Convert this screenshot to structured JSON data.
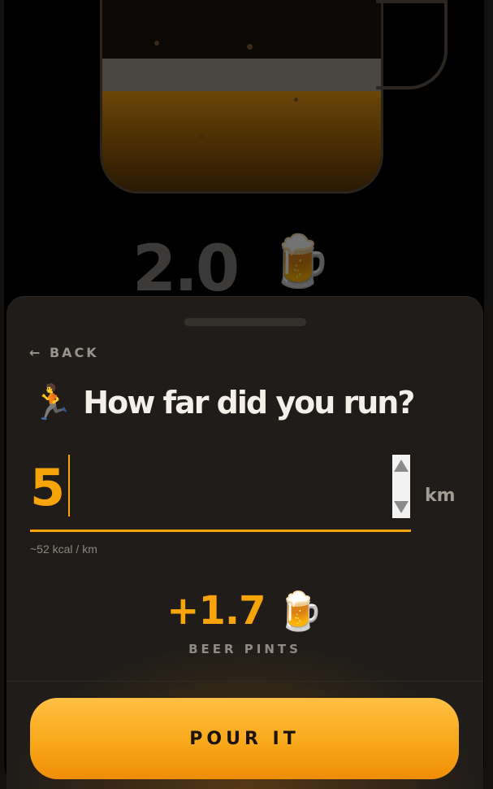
{
  "background": {
    "pints_value": "2.0",
    "pints_icon": "🍺"
  },
  "sheet": {
    "back_label": "← BACK",
    "activity_emoji": "🏃",
    "question": "How far did you run?",
    "distance_input": {
      "value": "5"
    },
    "unit": "km",
    "hint": "~52 kcal / km",
    "result": {
      "value": "+1.7",
      "icon": "🍺",
      "label": "BEER PINTS"
    },
    "pour_button_label": "POUR IT"
  },
  "colors": {
    "accent": "#f6a40a",
    "sheet_background": "#1f1c19",
    "button_gradient_top": "#ffc043",
    "button_gradient_bottom": "#ee8d06"
  }
}
